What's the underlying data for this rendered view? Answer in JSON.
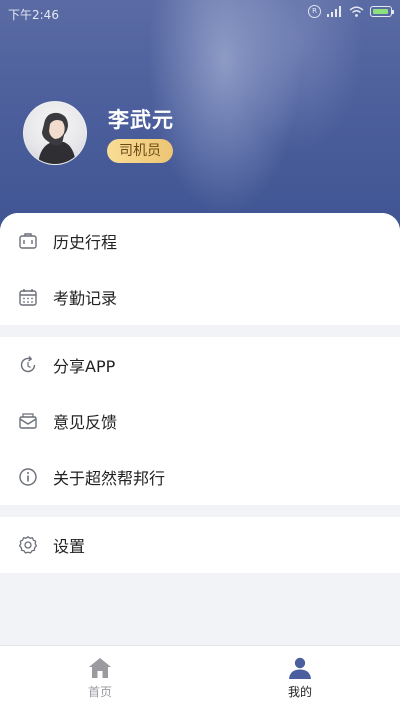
{
  "status_bar": {
    "time": "下午2:46",
    "r_badge": "R"
  },
  "profile": {
    "name": "李武元",
    "role": "司机员"
  },
  "menu_groups": [
    [
      {
        "label": "历史行程",
        "icon": "suitcase-icon"
      },
      {
        "label": "考勤记录",
        "icon": "calendar-icon"
      }
    ],
    [
      {
        "label": "分享APP",
        "icon": "share-refresh-icon"
      },
      {
        "label": "意见反馈",
        "icon": "feedback-envelope-icon"
      },
      {
        "label": "关于超然帮邦行",
        "icon": "info-icon"
      }
    ],
    [
      {
        "label": "设置",
        "icon": "gear-icon"
      }
    ]
  ],
  "tabbar": {
    "home": "首页",
    "me": "我的"
  },
  "colors": {
    "accent": "#4b5e9d",
    "badge": "#f2cf82",
    "icon_gray": "#6b6f78"
  }
}
